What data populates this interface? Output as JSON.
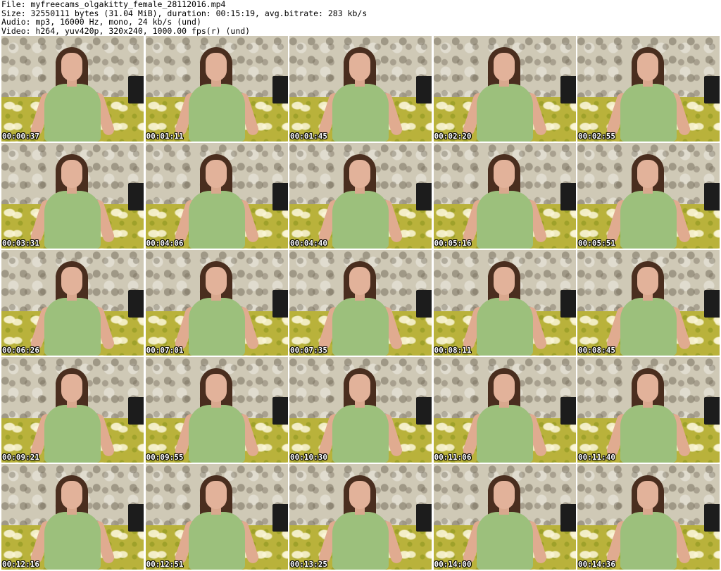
{
  "header": {
    "file_line": "File: myfreecams_olgakitty_female_28112016.mp4",
    "size_line": "Size: 32550111 bytes (31.04 MiB), duration: 00:15:19, avg.bitrate: 283 kb/s",
    "audio_line": "Audio: mp3, 16000 Hz, mono, 24 kb/s (und)",
    "video_line": "Video: h264, yuv420p, 320x240, 1000.00 fps(r) (und)"
  },
  "thumbnails": [
    {
      "timestamp": "00:00:37"
    },
    {
      "timestamp": "00:01:11"
    },
    {
      "timestamp": "00:01:45"
    },
    {
      "timestamp": "00:02:20"
    },
    {
      "timestamp": "00:02:55"
    },
    {
      "timestamp": "00:03:31"
    },
    {
      "timestamp": "00:04:06"
    },
    {
      "timestamp": "00:04:40"
    },
    {
      "timestamp": "00:05:16"
    },
    {
      "timestamp": "00:05:51"
    },
    {
      "timestamp": "00:06:26"
    },
    {
      "timestamp": "00:07:01"
    },
    {
      "timestamp": "00:07:35"
    },
    {
      "timestamp": "00:08:11"
    },
    {
      "timestamp": "00:08:45"
    },
    {
      "timestamp": "00:09:21"
    },
    {
      "timestamp": "00:09:55"
    },
    {
      "timestamp": "00:10:30"
    },
    {
      "timestamp": "00:11:06"
    },
    {
      "timestamp": "00:11:40"
    },
    {
      "timestamp": "00:12:16"
    },
    {
      "timestamp": "00:12:51"
    },
    {
      "timestamp": "00:13:25"
    },
    {
      "timestamp": "00:14:00"
    },
    {
      "timestamp": "00:14:36"
    }
  ],
  "colors": {
    "background": "#ffffff",
    "header_text": "#000000",
    "timestamp_text": "#ffffff",
    "timestamp_outline": "#000000",
    "shirt": "#9cc07c",
    "bedspread": "#b9b23b"
  }
}
